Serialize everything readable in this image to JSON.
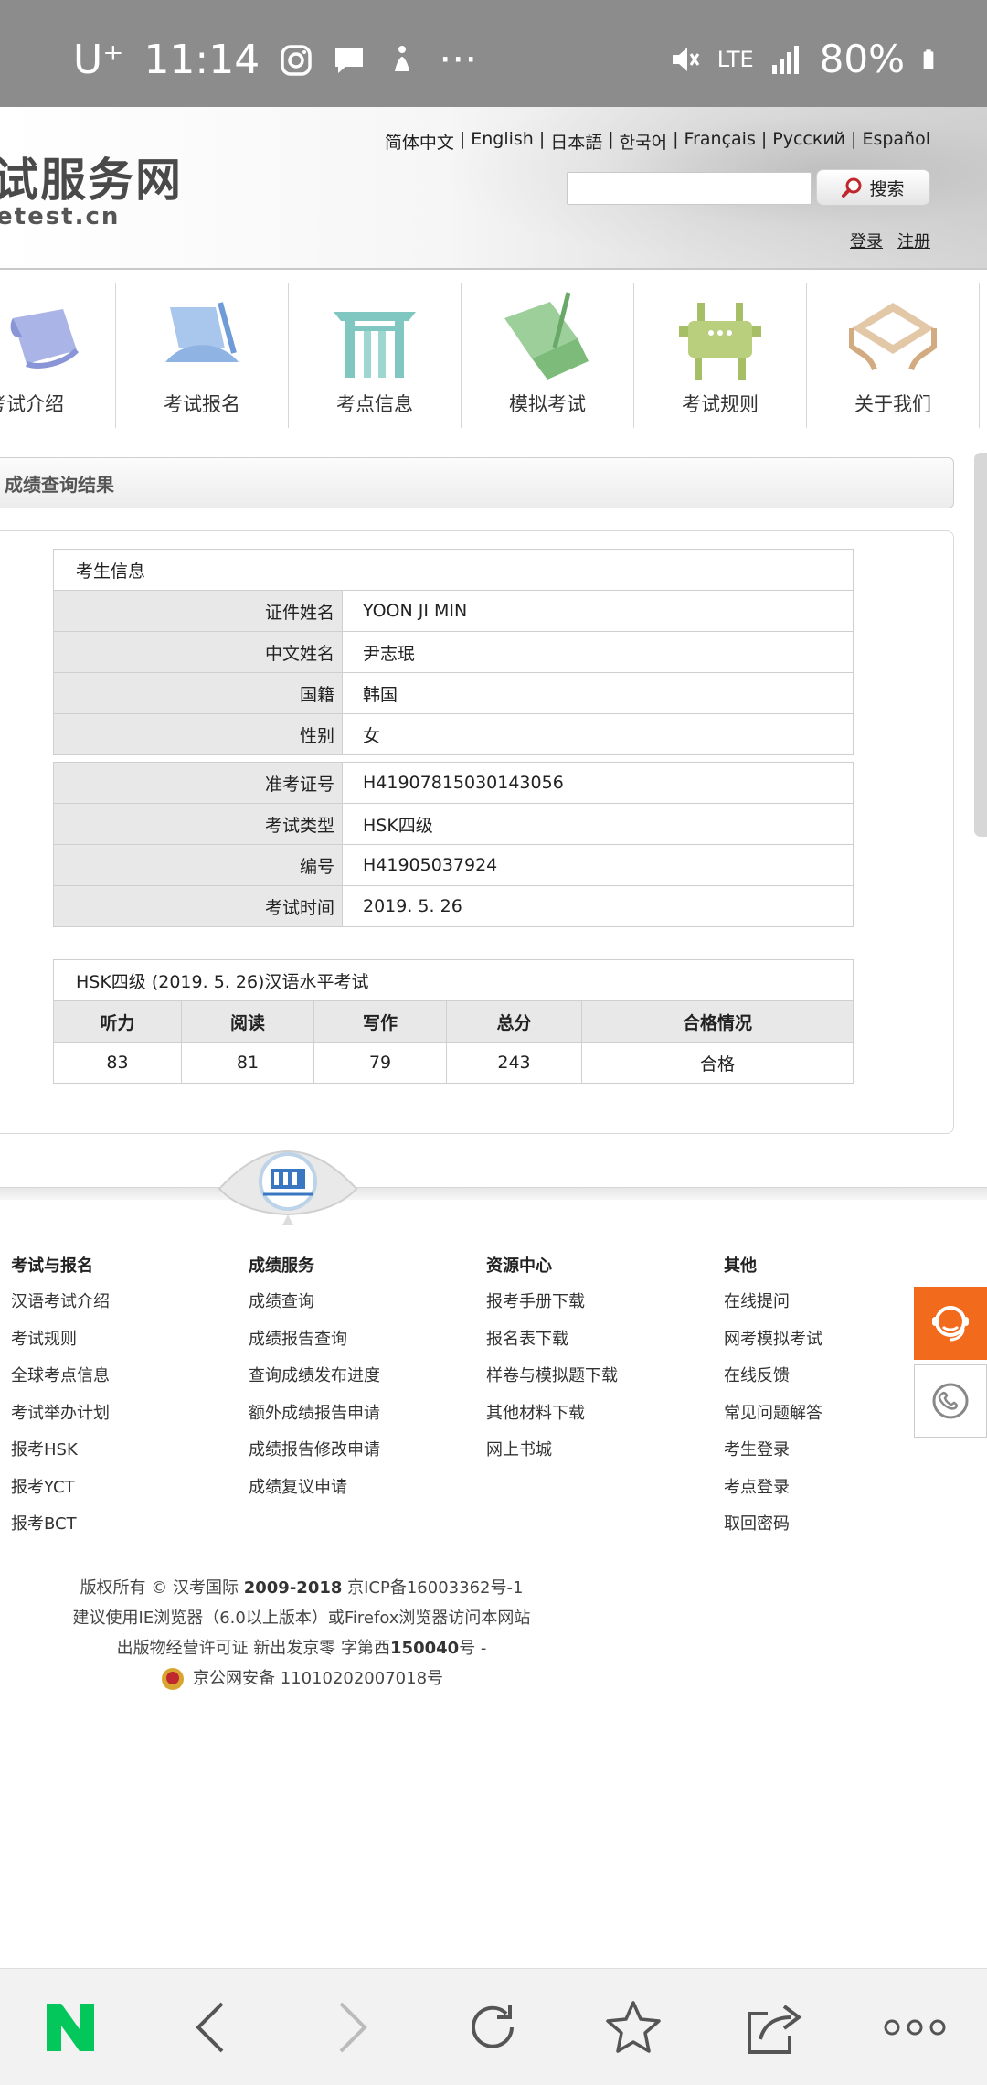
{
  "status_bar": {
    "carrier": "U⁺",
    "time": "11:14",
    "network": "LTE",
    "battery": "80%"
  },
  "header": {
    "site_name": "试服务网",
    "site_domain": "etest.cn",
    "languages": [
      "简体中文",
      "English",
      "日本語",
      "한국어",
      "Français",
      "Русский",
      "Español"
    ],
    "search_placeholder": "",
    "search_button": "搜索",
    "login": "登录",
    "register": "注册"
  },
  "nav": {
    "items": [
      {
        "label": "考试介绍",
        "icon": "scroll-icon"
      },
      {
        "label": "考试报名",
        "icon": "fan-scroll-icon"
      },
      {
        "label": "考点信息",
        "icon": "gate-icon"
      },
      {
        "label": "模拟考试",
        "icon": "book-scroll-icon"
      },
      {
        "label": "考试规则",
        "icon": "ding-icon"
      },
      {
        "label": "关于我们",
        "icon": "table-icon"
      }
    ]
  },
  "result": {
    "title": "成绩查询结果",
    "candidate_header": "考生信息",
    "personal": [
      {
        "label": "证件姓名",
        "value": "YOON JI MIN"
      },
      {
        "label": "中文姓名",
        "value": "尹志珉"
      },
      {
        "label": "国籍",
        "value": "韩国"
      },
      {
        "label": "性别",
        "value": "女"
      }
    ],
    "exam": [
      {
        "label": "准考证号",
        "value": "H41907815030143056"
      },
      {
        "label": "考试类型",
        "value": "HSK四级"
      },
      {
        "label": "编号",
        "value": "H41905037924"
      },
      {
        "label": "考试时间",
        "value": "2019. 5. 26"
      }
    ],
    "score_header": "HSK四级 (2019. 5. 26)汉语水平考试",
    "score_columns": [
      "听力",
      "阅读",
      "写作",
      "总分",
      "合格情况"
    ],
    "score_values": [
      "83",
      "81",
      "79",
      "243",
      "合格"
    ]
  },
  "footer": {
    "columns": [
      {
        "title": "考试与报名",
        "links": [
          "汉语考试介绍",
          "考试规则",
          "全球考点信息",
          "考试举办计划",
          "报考HSK",
          "报考YCT",
          "报考BCT"
        ]
      },
      {
        "title": "成绩服务",
        "links": [
          "成绩查询",
          "成绩报告查询",
          "查询成绩发布进度",
          "额外成绩报告申请",
          "成绩报告修改申请",
          "成绩复议申请"
        ]
      },
      {
        "title": "资源中心",
        "links": [
          "报考手册下载",
          "报名表下载",
          "样卷与模拟题下载",
          "其他材料下载",
          "网上书城"
        ]
      },
      {
        "title": "其他",
        "links": [
          "在线提问",
          "网考模拟考试",
          "在线反馈",
          "常见问题解答",
          "考生登录",
          "考点登录",
          "取回密码"
        ]
      }
    ],
    "copyright_prefix": "版权所有 © 汉考国际 ",
    "copyright_years": "2009-2018",
    "icp": " 京ICP备16003362号-1",
    "browser_note": "建议使用IE浏览器（6.0以上版本）或Firefox浏览器访问本网站",
    "publish_prefix": "出版物经营许可证 新出发京零 字第西",
    "publish_number": "150040",
    "publish_suffix": "号 -",
    "police": "京公网安备 11010202007018号"
  },
  "colors": {
    "status_bar": "#8c8c8c",
    "chat_button": "#f26b1d",
    "naver_green": "#03c75a"
  }
}
